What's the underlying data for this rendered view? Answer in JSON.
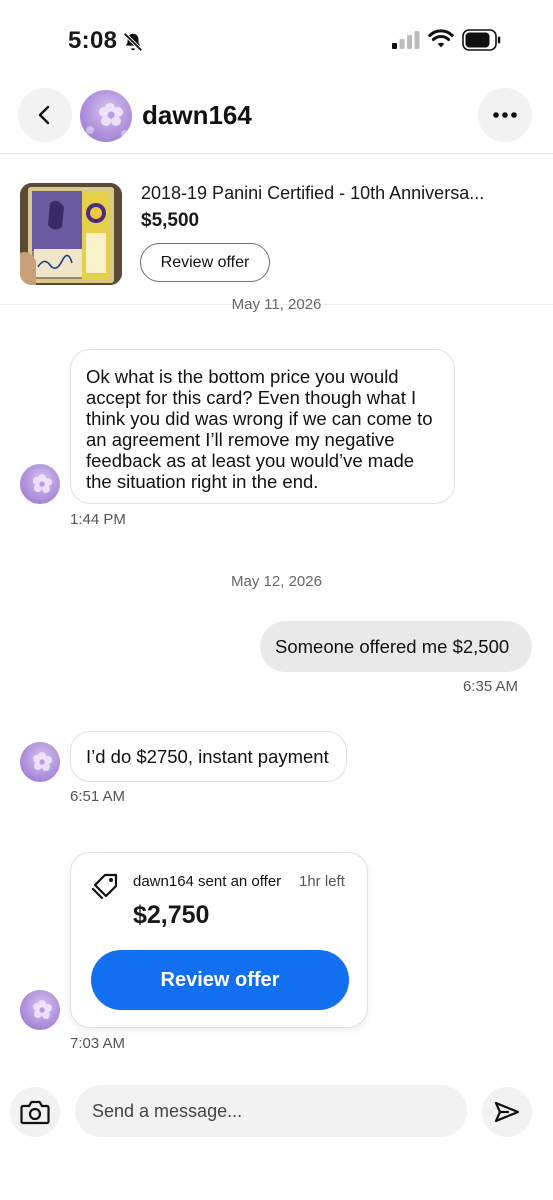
{
  "status_bar": {
    "time": "5:08",
    "icons": [
      "bell-slash-icon",
      "cellular-signal-icon",
      "wifi-icon",
      "battery-icon"
    ]
  },
  "header": {
    "back_icon": "chevron-left-icon",
    "username": "dawn164",
    "more_icon": "ellipsis-icon"
  },
  "listing": {
    "title": "2018-19 Panini Certified - 10th Anniversa...",
    "price": "$5,500",
    "review_button": "Review offer"
  },
  "chat": {
    "date_1": "May 11, 2026",
    "message_1": {
      "lines": [
        "Ok what is the bottom price you would",
        "accept for this card? Even though what I",
        "think you did was wrong if we can come to",
        "an agreement I’ll remove my negative",
        "feedback as at least you would’ve made",
        "the situation right in the end."
      ],
      "time": "1:44 PM"
    },
    "date_2": "May 12, 2026",
    "message_2": {
      "text": "Someone offered me $2,500",
      "time": "6:35 AM"
    },
    "message_3": {
      "text": "I’d do $2750, instant payment",
      "time": "6:51 AM"
    },
    "offer": {
      "text": "dawn164 sent an offer",
      "time_left": "1hr left",
      "amount": "$2,750",
      "button": "Review offer",
      "time": "7:03 AM"
    }
  },
  "composer": {
    "placeholder": "Send a message...",
    "camera_icon": "camera-icon",
    "send_icon": "send-icon"
  },
  "colors": {
    "primary_button": "#1270f0",
    "outgoing_bubble": "#e9e9e9",
    "avatar_purple": "#b79be0"
  }
}
